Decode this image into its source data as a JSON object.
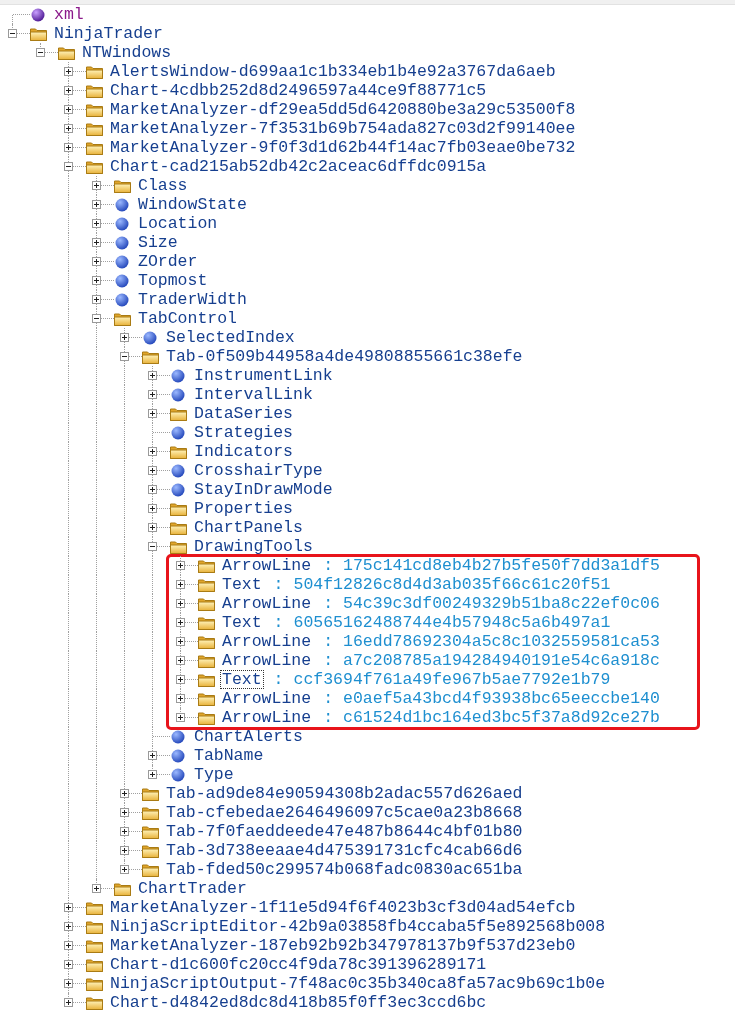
{
  "tree": [
    {
      "label": "xml",
      "kind": "declaration",
      "expandable": false,
      "selected": false
    },
    {
      "label": "NinjaTrader",
      "kind": "folder",
      "expandable": true,
      "expanded": true,
      "selected": false,
      "children": [
        {
          "label": "NTWindows",
          "kind": "folder",
          "expandable": true,
          "expanded": true,
          "selected": false,
          "children": [
            {
              "label": "AlertsWindow-d699aa1c1b334eb1b4e92a3767da6aeb",
              "kind": "folder",
              "expandable": true,
              "expanded": false,
              "selected": false
            },
            {
              "label": "Chart-4cdbb252d8d2496597a44ce9f88771c5",
              "kind": "folder",
              "expandable": true,
              "expanded": false,
              "selected": false
            },
            {
              "label": "MarketAnalyzer-df29ea5dd5d6420880be3a29c53500f8",
              "kind": "folder",
              "expandable": true,
              "expanded": false,
              "selected": false
            },
            {
              "label": "MarketAnalyzer-7f3531b69b754ada827c03d2f99140ee",
              "kind": "folder",
              "expandable": true,
              "expanded": false,
              "selected": false
            },
            {
              "label": "MarketAnalyzer-9f0f3d1d62b44f14ac7fb03eae0be732",
              "kind": "folder",
              "expandable": true,
              "expanded": false,
              "selected": false
            },
            {
              "label": "Chart-cad215ab52db42c2aceac6dffdc0915a",
              "kind": "folder",
              "expandable": true,
              "expanded": true,
              "selected": false,
              "children": [
                {
                  "label": "Class",
                  "kind": "folder",
                  "expandable": true,
                  "expanded": false,
                  "selected": false
                },
                {
                  "label": "WindowState",
                  "kind": "element",
                  "expandable": true,
                  "expanded": false,
                  "selected": false
                },
                {
                  "label": "Location",
                  "kind": "element",
                  "expandable": true,
                  "expanded": false,
                  "selected": false
                },
                {
                  "label": "Size",
                  "kind": "element",
                  "expandable": true,
                  "expanded": false,
                  "selected": false
                },
                {
                  "label": "ZOrder",
                  "kind": "element",
                  "expandable": true,
                  "expanded": false,
                  "selected": false
                },
                {
                  "label": "Topmost",
                  "kind": "element",
                  "expandable": true,
                  "expanded": false,
                  "selected": false
                },
                {
                  "label": "TraderWidth",
                  "kind": "element",
                  "expandable": true,
                  "expanded": false,
                  "selected": false
                },
                {
                  "label": "TabControl",
                  "kind": "folder",
                  "expandable": true,
                  "expanded": true,
                  "selected": false,
                  "children": [
                    {
                      "label": "SelectedIndex",
                      "kind": "element",
                      "expandable": true,
                      "expanded": false,
                      "selected": false
                    },
                    {
                      "label": "Tab-0f509b44958a4de49808855661c38efe",
                      "kind": "folder",
                      "expandable": true,
                      "expanded": true,
                      "selected": false,
                      "children": [
                        {
                          "label": "InstrumentLink",
                          "kind": "element",
                          "expandable": true,
                          "expanded": false,
                          "selected": false
                        },
                        {
                          "label": "IntervalLink",
                          "kind": "element",
                          "expandable": true,
                          "expanded": false,
                          "selected": false
                        },
                        {
                          "label": "DataSeries",
                          "kind": "folder",
                          "expandable": true,
                          "expanded": false,
                          "selected": false
                        },
                        {
                          "label": "Strategies",
                          "kind": "element",
                          "expandable": false,
                          "selected": false
                        },
                        {
                          "label": "Indicators",
                          "kind": "folder",
                          "expandable": true,
                          "expanded": false,
                          "selected": false
                        },
                        {
                          "label": "CrosshairType",
                          "kind": "element",
                          "expandable": true,
                          "expanded": false,
                          "selected": false
                        },
                        {
                          "label": "StayInDrawMode",
                          "kind": "element",
                          "expandable": true,
                          "expanded": false,
                          "selected": false
                        },
                        {
                          "label": "Properties",
                          "kind": "folder",
                          "expandable": true,
                          "expanded": false,
                          "selected": false
                        },
                        {
                          "label": "ChartPanels",
                          "kind": "folder",
                          "expandable": true,
                          "expanded": false,
                          "selected": false
                        },
                        {
                          "label": "DrawingTools",
                          "kind": "folder",
                          "expandable": true,
                          "expanded": true,
                          "selected": false,
                          "highlighted": true,
                          "children": [
                            {
                              "label": "ArrowLine",
                              "separator": ":",
                              "value": "175c141cd8eb4b27b5fe50f7dd3a1df5",
                              "kind": "folder",
                              "expandable": true,
                              "expanded": false,
                              "selected": false
                            },
                            {
                              "label": "Text",
                              "separator": ":",
                              "value": "504f12826c8d4d3ab035f66c61c20f51",
                              "kind": "folder",
                              "expandable": true,
                              "expanded": false,
                              "selected": false
                            },
                            {
                              "label": "ArrowLine",
                              "separator": ":",
                              "value": "54c39c3df00249329b51ba8c22ef0c06",
                              "kind": "folder",
                              "expandable": true,
                              "expanded": false,
                              "selected": false
                            },
                            {
                              "label": "Text",
                              "separator": ":",
                              "value": "60565162488744e4b57948c5a6b497a1",
                              "kind": "folder",
                              "expandable": true,
                              "expanded": false,
                              "selected": false
                            },
                            {
                              "label": "ArrowLine",
                              "separator": ":",
                              "value": "16edd78692304a5c8c1032559581ca53",
                              "kind": "folder",
                              "expandable": true,
                              "expanded": false,
                              "selected": false
                            },
                            {
                              "label": "ArrowLine",
                              "separator": ":",
                              "value": "a7c208785a194284940191e54c6a918c",
                              "kind": "folder",
                              "expandable": true,
                              "expanded": false,
                              "selected": false
                            },
                            {
                              "label": "Text",
                              "separator": ":",
                              "value": "ccf3694f761a49fe967b5ae7792e1b79",
                              "kind": "folder",
                              "expandable": true,
                              "expanded": false,
                              "selected": true
                            },
                            {
                              "label": "ArrowLine",
                              "separator": ":",
                              "value": "e0aef5a43bcd4f93938bc65eeccbe140",
                              "kind": "folder",
                              "expandable": true,
                              "expanded": false,
                              "selected": false
                            },
                            {
                              "label": "ArrowLine",
                              "separator": ":",
                              "value": "c61524d1bc164ed3bc5f37a8d92ce27b",
                              "kind": "folder",
                              "expandable": true,
                              "expanded": false,
                              "selected": false
                            }
                          ]
                        },
                        {
                          "label": "ChartAlerts",
                          "kind": "element",
                          "expandable": false,
                          "selected": false
                        },
                        {
                          "label": "TabName",
                          "kind": "element",
                          "expandable": true,
                          "expanded": false,
                          "selected": false
                        },
                        {
                          "label": "Type",
                          "kind": "element",
                          "expandable": true,
                          "expanded": false,
                          "selected": false
                        }
                      ]
                    },
                    {
                      "label": "Tab-ad9de84e90594308b2adac557d626aed",
                      "kind": "folder",
                      "expandable": true,
                      "expanded": false,
                      "selected": false
                    },
                    {
                      "label": "Tab-cfebedae2646496097c5cae0a23b8668",
                      "kind": "folder",
                      "expandable": true,
                      "expanded": false,
                      "selected": false
                    },
                    {
                      "label": "Tab-7f0faeddeede47e487b8644c4bf01b80",
                      "kind": "folder",
                      "expandable": true,
                      "expanded": false,
                      "selected": false
                    },
                    {
                      "label": "Tab-3d738eeaae4d475391731cfc4cab66d6",
                      "kind": "folder",
                      "expandable": true,
                      "expanded": false,
                      "selected": false
                    },
                    {
                      "label": "Tab-fded50c299574b068fadc0830ac651ba",
                      "kind": "folder",
                      "expandable": true,
                      "expanded": false,
                      "selected": false
                    }
                  ]
                },
                {
                  "label": "ChartTrader",
                  "kind": "folder",
                  "expandable": true,
                  "expanded": false,
                  "selected": false
                }
              ]
            },
            {
              "label": "MarketAnalyzer-1f11e5d94f6f4023b3cf3d04ad54efcb",
              "kind": "folder",
              "expandable": true,
              "expanded": false,
              "selected": false
            },
            {
              "label": "NinjaScriptEditor-42b9a03858fb4ccaba5f5e892568b008",
              "kind": "folder",
              "expandable": true,
              "expanded": false,
              "selected": false
            },
            {
              "label": "MarketAnalyzer-187eb92b92b347978137b9f537d23eb0",
              "kind": "folder",
              "expandable": true,
              "expanded": false,
              "selected": false
            },
            {
              "label": "Chart-d1c600fc20cc4f9da78c391396289171",
              "kind": "folder",
              "expandable": true,
              "expanded": false,
              "selected": false
            },
            {
              "label": "NinjaScriptOutput-7f48ac0c35b340ca8fa57ac9b69c1b0e",
              "kind": "folder",
              "expandable": true,
              "expanded": false,
              "selected": false
            },
            {
              "label": "Chart-d4842ed8dc8d418b85f0ff3ec3ccd6bc",
              "kind": "folder",
              "expandable": true,
              "expanded": false,
              "selected": false
            }
          ]
        }
      ]
    }
  ]
}
